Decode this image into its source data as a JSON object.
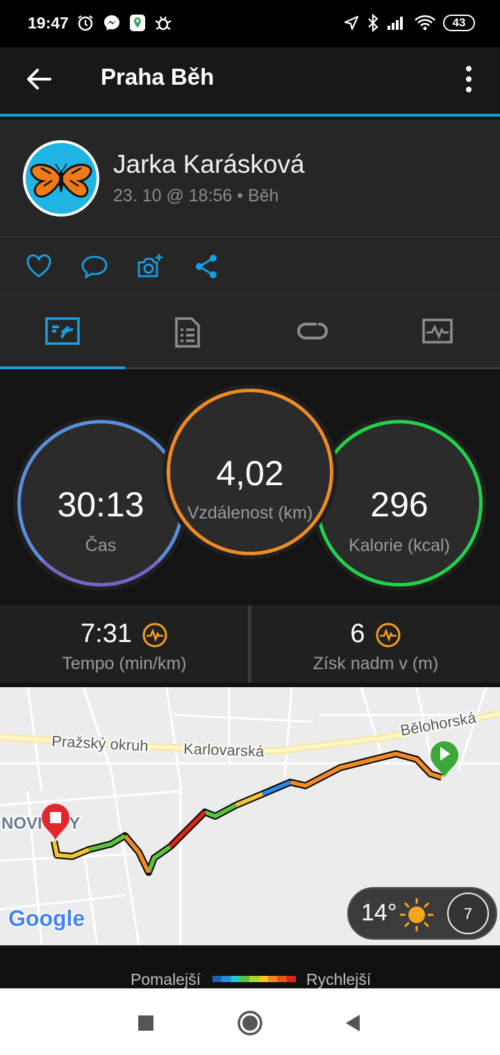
{
  "status_bar": {
    "time": "19:47",
    "battery": "43",
    "left_icons": [
      "alarm-icon",
      "messenger-icon",
      "maps-icon",
      "bug-icon"
    ],
    "right_icons": [
      "location-icon",
      "bluetooth-icon",
      "signal-icon",
      "wifi-icon"
    ]
  },
  "app_bar": {
    "title": "Praha Běh",
    "back_icon": "arrow-back-icon",
    "menu_icon": "more-vert-icon"
  },
  "profile": {
    "name": "Jarka Karásková",
    "meta": "23. 10 @ 18:56 • Běh",
    "avatar_icon": "butterfly-icon"
  },
  "actions": [
    "heart-icon",
    "comment-icon",
    "add-photo-icon",
    "share-icon"
  ],
  "tabs": [
    "overview-tab",
    "details-tab",
    "laps-tab",
    "charts-tab"
  ],
  "stats": {
    "time": {
      "value": "30:13",
      "label": "Čas"
    },
    "distance": {
      "value": "4,02",
      "label": "Vzdálenost (km)"
    },
    "calories": {
      "value": "296",
      "label": "Kalorie (kcal)"
    }
  },
  "summary": {
    "pace": {
      "value": "7:31",
      "label": "Tempo (min/km)"
    },
    "elevation": {
      "value": "6",
      "label": "Získ nadm v (m)"
    }
  },
  "map": {
    "road_1": "Pražský okruh",
    "road_2": "Karlovarská",
    "road_3": "Bělohorská",
    "district": "NOVÉ ŘEPY",
    "district_visible": "NOVI EPY",
    "attribution": "Google",
    "weather": {
      "temp": "14°",
      "wind": "7"
    }
  },
  "legend": {
    "slow": "Pomalejší",
    "fast": "Rychlejší",
    "colors": [
      "#1f5fb8",
      "#2b8ae0",
      "#2ec4c4",
      "#5bc23c",
      "#a8d431",
      "#f2c72e",
      "#f08a24",
      "#e8531e",
      "#d9261c"
    ]
  },
  "colors": {
    "accent": "#1b9ee0",
    "time_ring": "#5a8fdc",
    "distance_ring": "#f08a24",
    "calorie_ring": "#20d24a",
    "hr_icon": "#f4a020"
  }
}
